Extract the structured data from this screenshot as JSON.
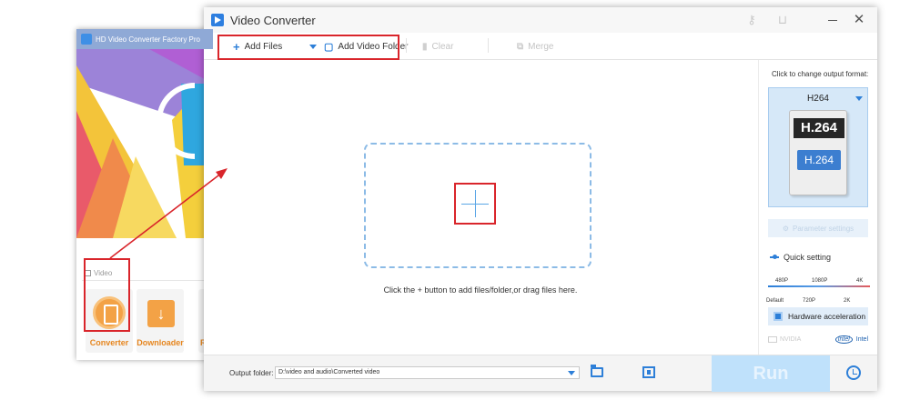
{
  "back_window": {
    "title": "HD Video Converter Factory Pro",
    "section_label": "Video",
    "tiles": [
      {
        "label": "Converter"
      },
      {
        "label": "Downloader"
      },
      {
        "label": "R"
      }
    ]
  },
  "main_window": {
    "title": "Video Converter",
    "toolbar": {
      "add_files": "Add Files",
      "add_video_folder": "Add Video Folder",
      "clear": "Clear",
      "merge": "Merge"
    },
    "dropzone_hint": "Click the + button to add files/folder,or drag files here.",
    "panel": {
      "hint": "Click to change output format:",
      "format_name": "H264",
      "format_badge_top": "H.264",
      "format_badge_bottom": "H.264",
      "parameter_button": "Parameter settings",
      "quick_setting": "Quick setting",
      "quality_top": [
        "480P",
        "1080P",
        "4K"
      ],
      "quality_bottom": [
        "Default",
        "720P",
        "2K"
      ],
      "hw_accel": "Hardware acceleration",
      "vendor_nvidia": "NVIDIA",
      "vendor_intel": "Intel"
    },
    "bottom": {
      "output_label": "Output folder:",
      "output_path": "D:\\video and audio\\Converted video",
      "run_label": "Run"
    }
  },
  "colors": {
    "highlight_red": "#d9252b",
    "accent_blue": "#2d7fd8",
    "run_disabled": "#bfe1fb"
  }
}
